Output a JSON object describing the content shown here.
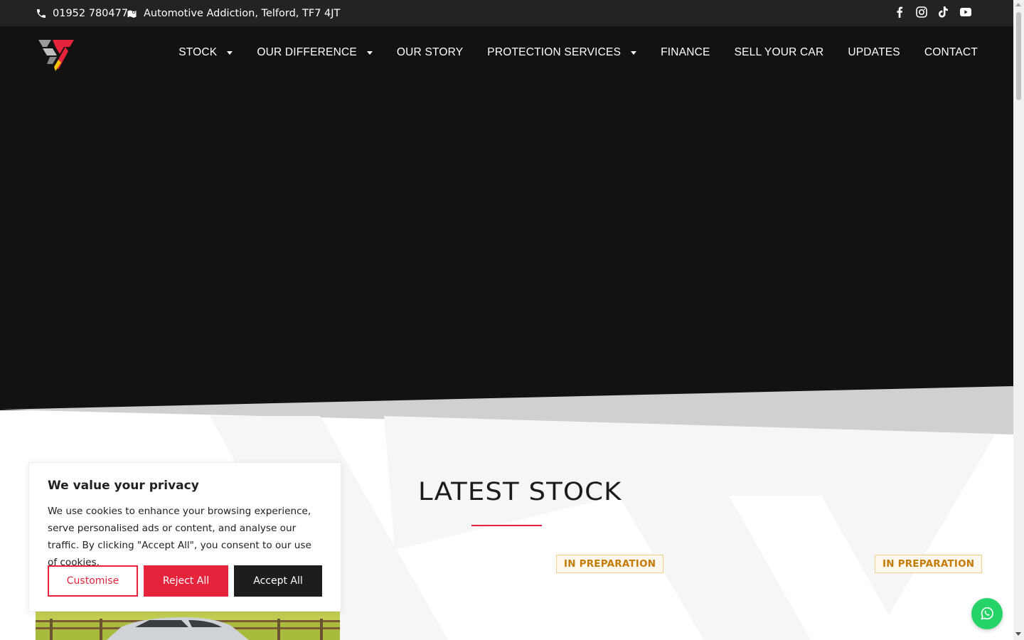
{
  "topbar": {
    "phone": "01952 780477",
    "address": "Automotive Addiction, Telford, TF7 4JT",
    "socials": [
      "facebook-icon",
      "instagram-icon",
      "tiktok-icon",
      "youtube-icon"
    ]
  },
  "nav": {
    "items": [
      {
        "label": "STOCK",
        "has_dropdown": true
      },
      {
        "label": "OUR DIFFERENCE",
        "has_dropdown": true
      },
      {
        "label": "OUR STORY",
        "has_dropdown": false
      },
      {
        "label": "PROTECTION SERVICES",
        "has_dropdown": true
      },
      {
        "label": "FINANCE",
        "has_dropdown": false
      },
      {
        "label": "SELL YOUR CAR",
        "has_dropdown": false
      },
      {
        "label": "UPDATES",
        "has_dropdown": false
      },
      {
        "label": "CONTACT",
        "has_dropdown": false
      }
    ]
  },
  "stock": {
    "title": "LATEST STOCK",
    "badges": [
      "IN PREPARATION",
      "IN PREPARATION"
    ]
  },
  "cookie": {
    "title": "We value your privacy",
    "body": "We use cookies to enhance your browsing experience, serve personalised ads or content, and analyse our traffic. By clicking \"Accept All\", you consent to our use of cookies.",
    "customise": "Customise",
    "reject": "Reject All",
    "accept": "Accept All"
  },
  "colors": {
    "accent": "#e5243b",
    "header_bg": "#121212",
    "topbar_bg": "#232323",
    "badge_text": "#c47b00",
    "whatsapp": "#25d366"
  }
}
